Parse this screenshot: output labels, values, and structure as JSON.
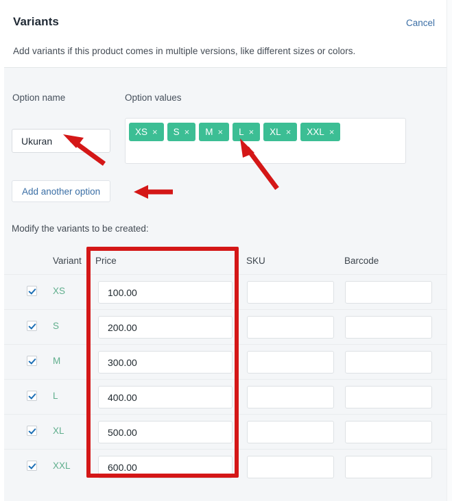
{
  "header": {
    "title": "Variants",
    "cancel_label": "Cancel",
    "subtitle": "Add variants if this product comes in multiple versions, like different sizes or colors."
  },
  "option_section": {
    "option_name_label": "Option name",
    "option_values_label": "Option values",
    "option_name_value": "Ukuran",
    "option_name_placeholder": "",
    "option_values": [
      {
        "label": "XS",
        "remove": "×"
      },
      {
        "label": "S",
        "remove": "×"
      },
      {
        "label": "M",
        "remove": "×"
      },
      {
        "label": "L",
        "remove": "×"
      },
      {
        "label": "XL",
        "remove": "×"
      },
      {
        "label": "XXL",
        "remove": "×"
      }
    ],
    "add_option_label": "Add another option"
  },
  "table": {
    "caption": "Modify the variants to be created:",
    "columns": {
      "variant": "Variant",
      "price": "Price",
      "sku": "SKU",
      "barcode": "Barcode"
    },
    "rows": [
      {
        "checked": true,
        "variant": "XS",
        "price": "100.00",
        "sku": "",
        "barcode": ""
      },
      {
        "checked": true,
        "variant": "S",
        "price": "200.00",
        "sku": "",
        "barcode": ""
      },
      {
        "checked": true,
        "variant": "M",
        "price": "300.00",
        "sku": "",
        "barcode": ""
      },
      {
        "checked": true,
        "variant": "L",
        "price": "400.00",
        "sku": "",
        "barcode": ""
      },
      {
        "checked": true,
        "variant": "XL",
        "price": "500.00",
        "sku": "",
        "barcode": ""
      },
      {
        "checked": true,
        "variant": "XXL",
        "price": "600.00",
        "sku": "",
        "barcode": ""
      }
    ]
  },
  "annotations": {
    "highlight_color": "#d41717",
    "arrow_color": "#d41717",
    "arrows": [
      {
        "name": "arrow-to-option-name-input",
        "target": "option-name-input"
      },
      {
        "name": "arrow-to-option-value-chip-l",
        "target": "chip-L"
      },
      {
        "name": "arrow-to-add-another-option",
        "target": "add-another-option-button"
      }
    ],
    "boxes": [
      {
        "name": "price-column-highlight",
        "target": "price-column"
      }
    ]
  },
  "colors": {
    "chip_green": "#3cbe94",
    "link_blue": "#3a6ea5",
    "variant_green": "#5fae8c",
    "page_bg": "#f4f6f8",
    "annotation_red": "#d41717"
  }
}
